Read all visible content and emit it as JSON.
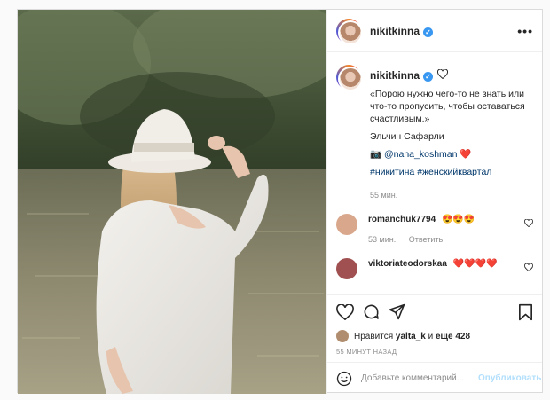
{
  "post": {
    "username": "nikitkinna",
    "verified_mark": "✓",
    "more_icon": "•••",
    "caption": {
      "line1": "«Порою нужно чего-то не знать или что-то пропусить, чтобы оставаться счастливым.»",
      "author": "Эльчин Сафарли",
      "credit_icon": "📷",
      "credit_link": "@nana_koshman",
      "credit_emoji": "❤️",
      "hashtags": "#никитина #женскийквартал",
      "time": "55 мин."
    },
    "comments": [
      {
        "user": "romanchuk7794",
        "text": "😍😍😍",
        "time": "53 мин.",
        "reply": "Ответить",
        "avatar_color": "#d9a88c"
      },
      {
        "user": "viktoriateodorskaa",
        "text": "❤️❤️❤️❤️",
        "time": "",
        "reply": "",
        "avatar_color": "#a05050"
      }
    ],
    "likes": {
      "prefix": "Нравится",
      "user": "yalta_k",
      "middle": "и",
      "count": "ещё 428"
    },
    "date": "55 МИНУТ НАЗАД",
    "add_comment": {
      "placeholder": "Добавьте комментарий...",
      "publish_label": "Опубликовать"
    }
  },
  "icons": {
    "like": "heart-icon",
    "comment": "comment-icon",
    "share": "share-icon",
    "save": "bookmark-icon",
    "emoji": "smiley-icon"
  }
}
